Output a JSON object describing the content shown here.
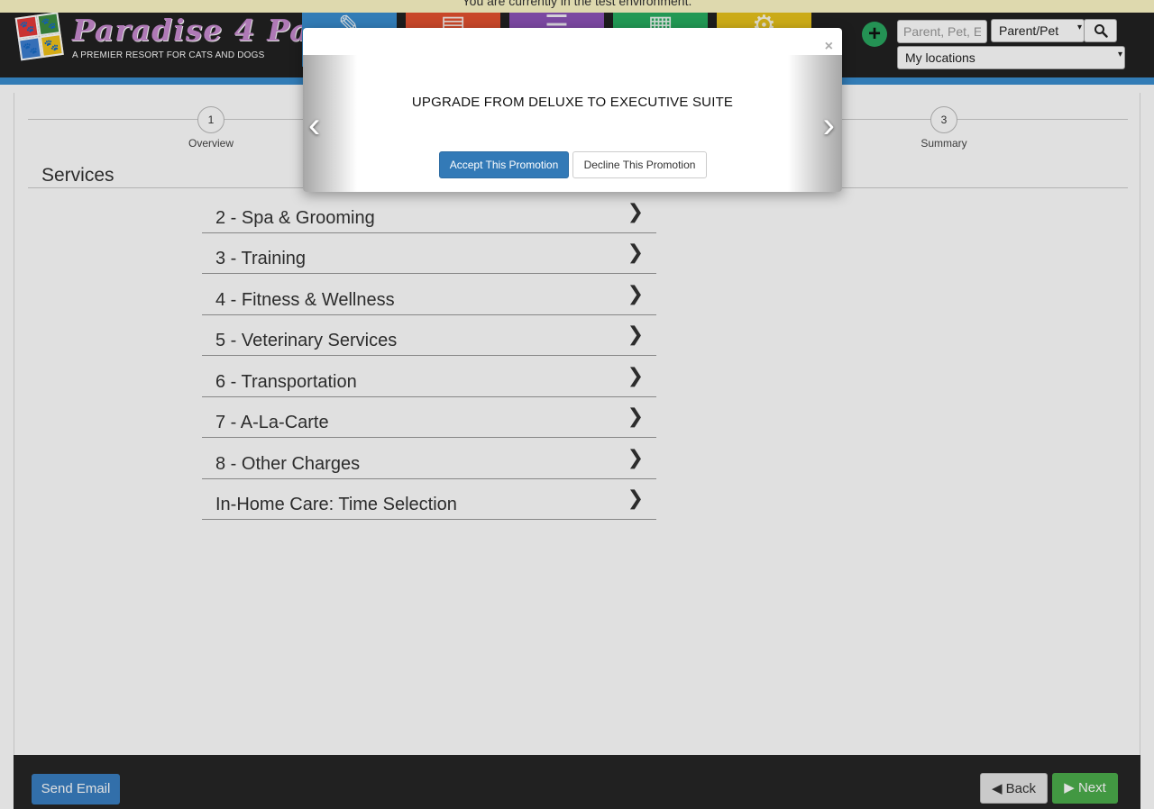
{
  "env_banner": "You are currently in the test environment.",
  "header": {
    "logo_title": "Paradise 4 Paws",
    "logo_subtitle": "A PREMIER RESORT FOR CATS AND DOGS",
    "search_placeholder": "Parent, Pet, E",
    "search_type": "Parent/Pet",
    "location": "My locations"
  },
  "stepper": {
    "steps": [
      {
        "number": "1",
        "label": "Overview"
      },
      {
        "number": "3",
        "label": "Summary"
      }
    ]
  },
  "services": {
    "title": "Services",
    "items": [
      "2 - Spa & Grooming",
      "3 - Training",
      "4 - Fitness & Wellness",
      "5 - Veterinary Services",
      "6 - Transportation",
      "7 - A-La-Carte",
      "8 - Other Charges",
      "In-Home Care: Time Selection"
    ]
  },
  "footer": {
    "send_email": "Send Email",
    "back": "Back",
    "next": "Next"
  },
  "modal": {
    "close": "×",
    "promo_title": "UPGRADE FROM DELUXE TO EXECUTIVE SUITE",
    "accept": "Accept This Promotion",
    "decline": "Decline This Promotion"
  },
  "colors": {
    "header_bg": "#212121",
    "accent_blue": "#3a8ed0",
    "accept_blue": "#337ab7",
    "next_green": "#4cae4c",
    "add_green": "#29a760"
  }
}
